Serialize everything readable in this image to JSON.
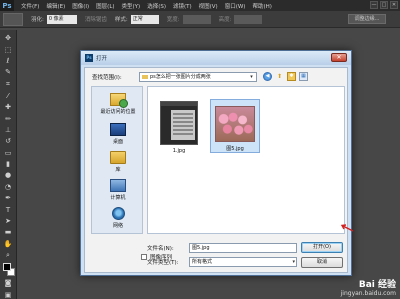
{
  "app": {
    "logo": "Ps",
    "menu": [
      "文件(F)",
      "编辑(E)",
      "图像(I)",
      "图层(L)",
      "类型(Y)",
      "选择(S)",
      "滤镜(T)",
      "视图(V)",
      "窗口(W)",
      "帮助(H)"
    ],
    "window_buttons": [
      "—",
      "□",
      "✕"
    ]
  },
  "options": {
    "feather_label": "羽化:",
    "feather_value": "0 像素",
    "antialias_label": "消除锯齿",
    "style_label": "样式:",
    "style_value": "正常",
    "width_label": "宽度:",
    "height_label": "高度:",
    "refine_button": "调整边缘..."
  },
  "dialog": {
    "title": "打开",
    "close": "✕",
    "look_in_label": "查找范围(I):",
    "look_in_value": "ps怎么把一张图片分成两张",
    "places": [
      {
        "label": "最近访问的位置",
        "icon": "recent-places-icon"
      },
      {
        "label": "桌面",
        "icon": "desktop-icon"
      },
      {
        "label": "库",
        "icon": "library-icon"
      },
      {
        "label": "计算机",
        "icon": "computer-icon"
      },
      {
        "label": "网络",
        "icon": "network-icon"
      }
    ],
    "files": [
      {
        "name": "1.jpg",
        "selected": false
      },
      {
        "name": "图5.jpg",
        "selected": true
      }
    ],
    "filename_label": "文件名(N):",
    "filename_value": "图5.jpg",
    "filetype_label": "文件类型(T):",
    "filetype_value": "所有格式",
    "open_button": "打开(O)",
    "cancel_button": "取消",
    "image_sequence_label": "图像序列"
  },
  "watermark": {
    "logo": "Bai 经验",
    "url": "jingyan.baidu.com"
  },
  "colors": {
    "annotation_arrow": "#d12020",
    "selection": "#cde3f8"
  }
}
